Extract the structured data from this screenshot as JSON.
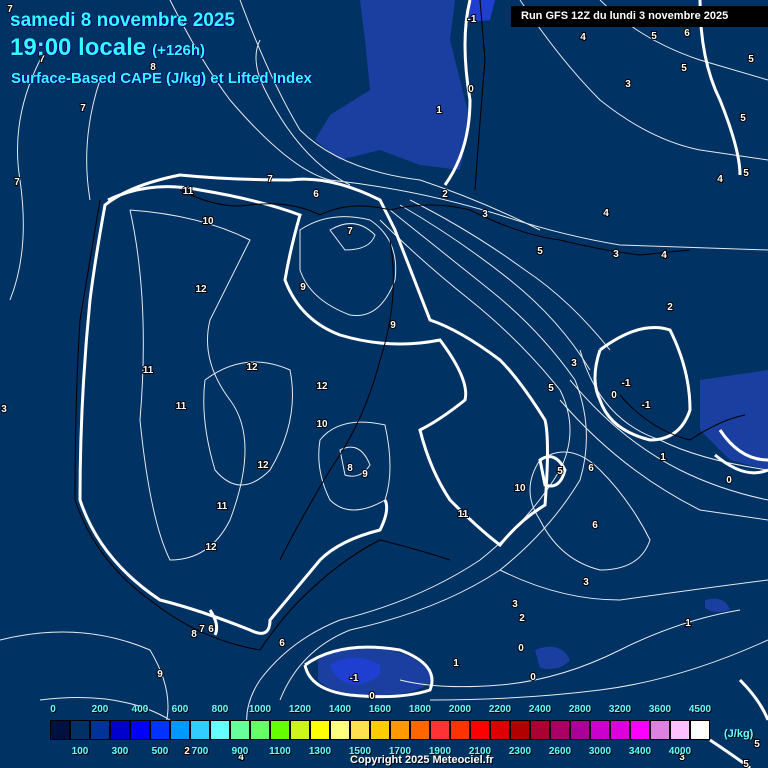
{
  "header": {
    "date": "samedi 8 novembre 2025",
    "time": "19:00 locale",
    "lead": "(+126h)",
    "parameter": "Surface-Based CAPE (J/kg) et Lifted Index",
    "run": "Run GFS 12Z du lundi 3 novembre 2025"
  },
  "legend": {
    "unit": "(J/kg)",
    "swatches": [
      {
        "value": 0,
        "color": "#001040"
      },
      {
        "value": 100,
        "color": "#003066"
      },
      {
        "value": 200,
        "color": "#003399"
      },
      {
        "value": 300,
        "color": "#0000cc"
      },
      {
        "value": 400,
        "color": "#0000ff"
      },
      {
        "value": 500,
        "color": "#0033ff"
      },
      {
        "value": 600,
        "color": "#0099ff"
      },
      {
        "value": 700,
        "color": "#33ccff"
      },
      {
        "value": 800,
        "color": "#66ffff"
      },
      {
        "value": 900,
        "color": "#66ff99"
      },
      {
        "value": 1000,
        "color": "#66ff66"
      },
      {
        "value": 1100,
        "color": "#66ff00"
      },
      {
        "value": 1200,
        "color": "#ccf51a"
      },
      {
        "value": 1300,
        "color": "#ffff00"
      },
      {
        "value": 1400,
        "color": "#ffff80"
      },
      {
        "value": 1500,
        "color": "#ffe050"
      },
      {
        "value": 1600,
        "color": "#ffcc00"
      },
      {
        "value": 1700,
        "color": "#ff9900"
      },
      {
        "value": 1800,
        "color": "#ff6600"
      },
      {
        "value": 1900,
        "color": "#ff3333"
      },
      {
        "value": 2000,
        "color": "#ff3300"
      },
      {
        "value": 2100,
        "color": "#ff0000"
      },
      {
        "value": 2200,
        "color": "#dd0000"
      },
      {
        "value": 2300,
        "color": "#b00000"
      },
      {
        "value": 2400,
        "color": "#aa0033"
      },
      {
        "value": 2600,
        "color": "#aa0066"
      },
      {
        "value": 2800,
        "color": "#aa0099"
      },
      {
        "value": 3000,
        "color": "#cc00cc"
      },
      {
        "value": 3200,
        "color": "#dd00dd"
      },
      {
        "value": 3400,
        "color": "#ff00ff"
      },
      {
        "value": 3600,
        "color": "#e080e0"
      },
      {
        "value": 4000,
        "color": "#ffc0ff"
      },
      {
        "value": 4500,
        "color": "#ffffff"
      }
    ],
    "top_labels": [
      "0",
      "200",
      "400",
      "600",
      "800",
      "1000",
      "1200",
      "1400",
      "1600",
      "1800",
      "2000",
      "2200",
      "2400",
      "2800",
      "3200",
      "3600",
      "4500"
    ],
    "bottom_labels": [
      "100",
      "300",
      "500",
      "700",
      "900",
      "1100",
      "1300",
      "1500",
      "1700",
      "1900",
      "2100",
      "2300",
      "2600",
      "3000",
      "3400",
      "4000"
    ]
  },
  "lifted_index_labels": [
    "7",
    "7",
    "8",
    "7",
    "7",
    "11",
    "10",
    "7",
    "12",
    "9",
    "9",
    "11",
    "12",
    "12",
    "11",
    "10",
    "8",
    "9",
    "12",
    "11",
    "12",
    "11",
    "10",
    "5",
    "6",
    "6",
    "3",
    "3",
    "2",
    "0",
    "1",
    "0",
    "-1",
    "0",
    "8",
    "7",
    "6",
    "9",
    "6",
    "1",
    "1",
    "0",
    "-1",
    "0",
    "-1",
    "3",
    "5",
    "2",
    "4",
    "3",
    "5",
    "4",
    "3",
    "2",
    "6",
    "7",
    "1",
    "0",
    "-1",
    "4",
    "5",
    "6",
    "5",
    "3",
    "5",
    "5",
    "4",
    "5",
    "3",
    "2",
    "4",
    "3",
    "5",
    "5"
  ],
  "copyright": "Copyright 2025 Meteociel.fr",
  "colors": {
    "background": "#003263",
    "cape_low": "#1a3fa0",
    "cape_mid": "#1f3fd0",
    "title": "#33ffff"
  }
}
